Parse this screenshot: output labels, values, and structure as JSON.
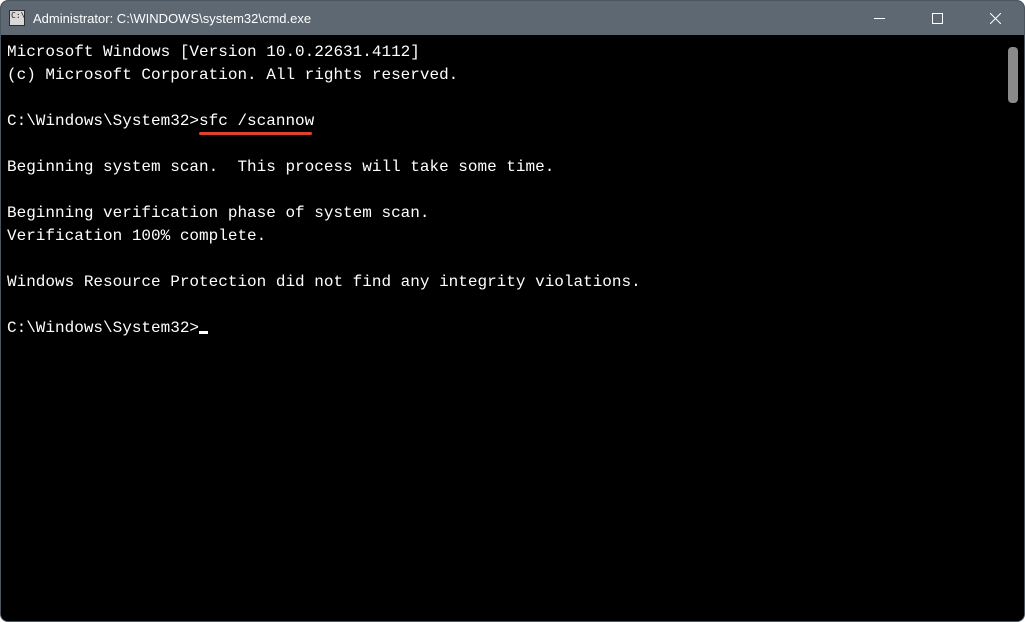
{
  "titlebar": {
    "icon_label": "cmd-icon",
    "title": "Administrator: C:\\WINDOWS\\system32\\cmd.exe"
  },
  "window_controls": {
    "minimize": "Minimize",
    "maximize": "Maximize",
    "close": "Close"
  },
  "terminal": {
    "line1": "Microsoft Windows [Version 10.0.22631.4112]",
    "line2": "(c) Microsoft Corporation. All rights reserved.",
    "blank": " ",
    "prompt1": "C:\\Windows\\System32>",
    "command1": "sfc /scannow",
    "line4": "Beginning system scan.  This process will take some time.",
    "line5": "Beginning verification phase of system scan.",
    "line6": "Verification 100% complete.",
    "line7": "Windows Resource Protection did not find any integrity violations.",
    "prompt2": "C:\\Windows\\System32>"
  }
}
